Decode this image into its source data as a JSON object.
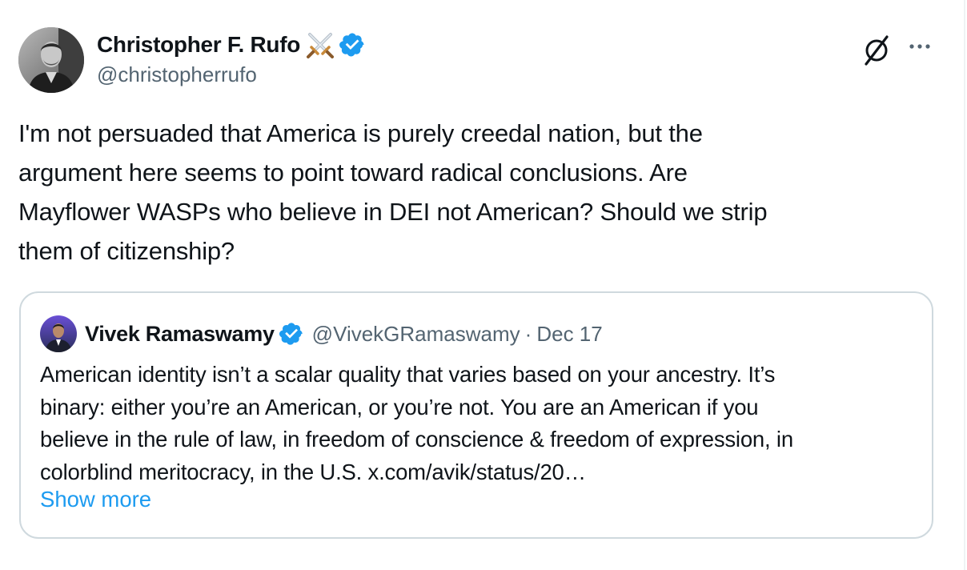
{
  "tweet": {
    "author": {
      "name": "Christopher F. Rufo",
      "handle": "@christopherrufo"
    },
    "text_lines": [
      "I'm not persuaded that America is purely creedal nation, but the",
      "argument here seems to point toward radical conclusions. Are",
      "Mayflower WASPs who believe in DEI not American? Should we strip",
      "them of citizenship?"
    ]
  },
  "quoted_tweet": {
    "author": {
      "name": "Vivek Ramaswamy",
      "handle": "@VivekGRamaswamy"
    },
    "separator": "·",
    "date": "Dec 17",
    "text_lines": [
      "American identity isn’t a scalar quality that varies based on your ancestry. It’s",
      "binary: either you’re an American, or you’re not. You are an American if you",
      "believe in the rule of law, in freedom of conscience & freedom of expression, in",
      "colorblind meritocracy, in the U.S. x.com/avik/status/20…"
    ],
    "show_more_label": "Show more"
  },
  "icons": {
    "author_badge": "crossed-swords-icon",
    "verified": "verified-badge-icon",
    "grok": "grok-icon",
    "more": "more-options-icon"
  },
  "colors": {
    "text_primary": "#0f1419",
    "text_secondary": "#536471",
    "link": "#1d9bf0",
    "verified": "#1d9bf0",
    "border": "#cfd9de"
  }
}
